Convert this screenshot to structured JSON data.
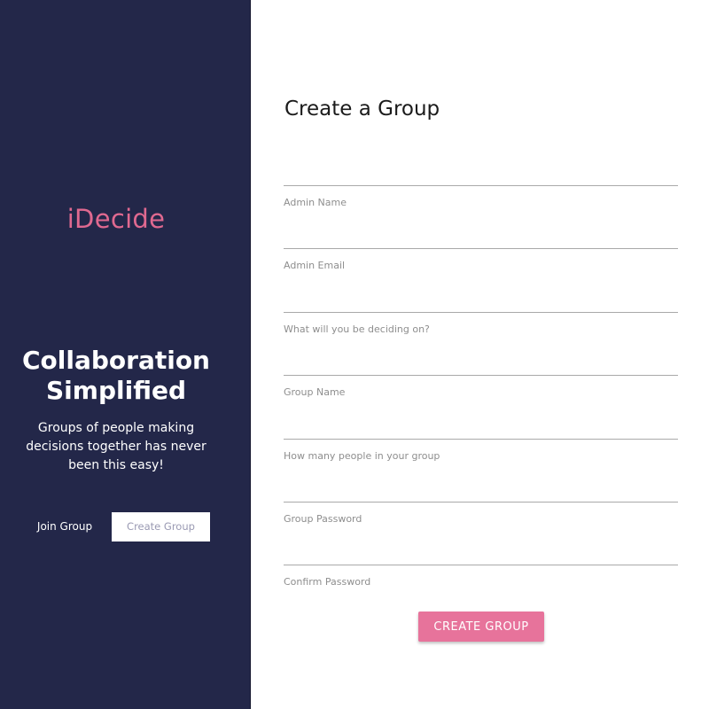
{
  "sidebar": {
    "logo": "iDecide",
    "headline_line1": "Collaboration",
    "headline_line2": "Simplified",
    "tagline": "Groups of people making decisions together has never been this easy!",
    "join_label": "Join Group",
    "create_label": "Create Group"
  },
  "form": {
    "title": "Create a Group",
    "fields": [
      {
        "label": "Admin Name",
        "value": ""
      },
      {
        "label": "Admin Email",
        "value": ""
      },
      {
        "label": "What will you be deciding on?",
        "value": ""
      },
      {
        "label": "Group Name",
        "value": ""
      },
      {
        "label": "How many people in your group",
        "value": ""
      },
      {
        "label": "Group Password",
        "value": ""
      },
      {
        "label": "Confirm Password",
        "value": ""
      }
    ],
    "submit_label": "CREATE GROUP"
  },
  "colors": {
    "sidebar_bg": "#232749",
    "logo": "#e06990",
    "accent_button": "#e7739b",
    "underline": "#a9a9a9",
    "label": "#8e8e8e"
  }
}
